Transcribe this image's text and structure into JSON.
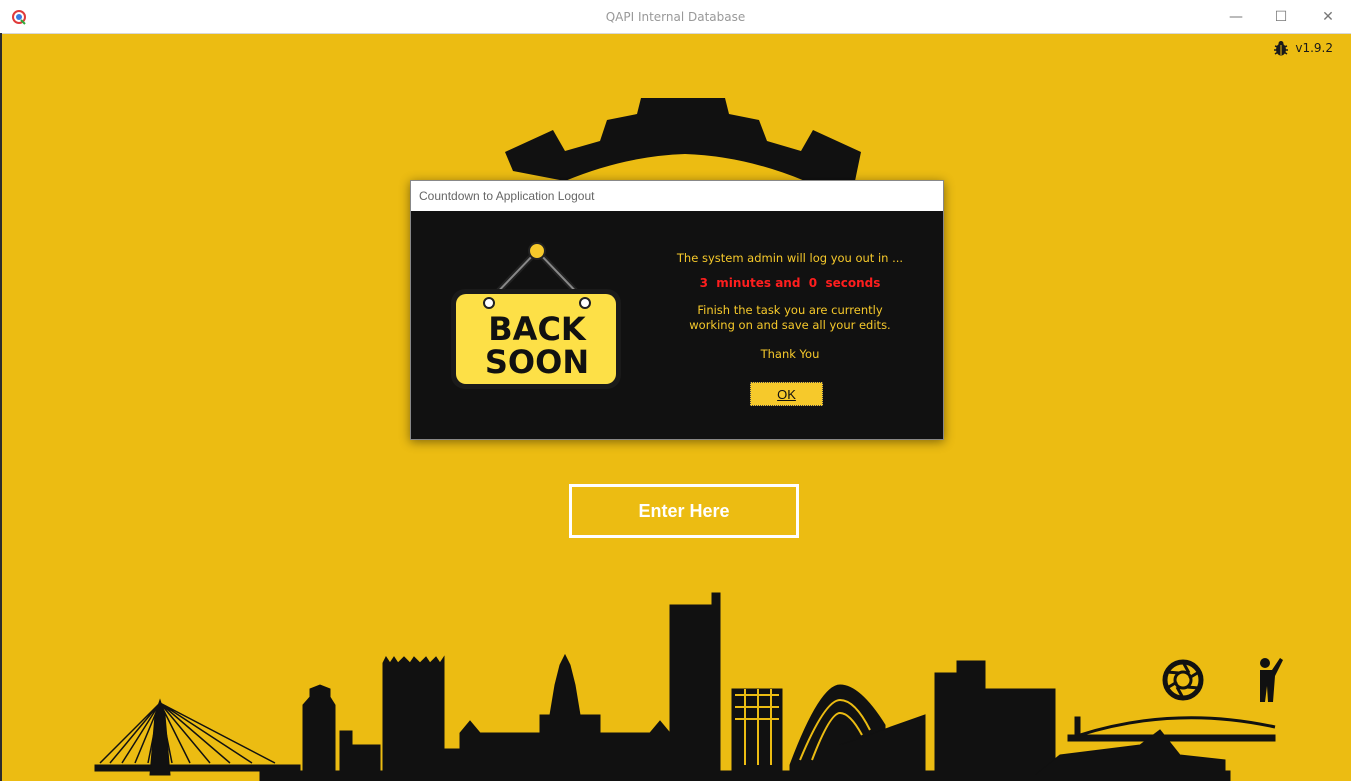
{
  "window": {
    "title": "QAPI Internal Database",
    "controls": {
      "minimize": "—",
      "maximize": "☐",
      "close": "✕"
    }
  },
  "header": {
    "version": "v1.9.2",
    "bug_icon": "bug-icon"
  },
  "main": {
    "enter_button": "Enter Here",
    "icons": [
      "gear-icon",
      "camera-aperture-icon",
      "waving-person-icon"
    ]
  },
  "dialog": {
    "title": "Countdown to Application Logout",
    "sign_line1": "BACK",
    "sign_line2": "SOON",
    "line1": "The system admin will log you out in ...",
    "countdown": "3  minutes and  0  seconds",
    "line3a": "Finish the task you are currently",
    "line3b": "working on and save all your edits.",
    "thanks": "Thank You",
    "ok_label": "OK"
  },
  "colors": {
    "background": "#ecbc12",
    "dialog_bg": "#111111",
    "accent_text": "#f6c92b",
    "countdown": "#ff1e1e"
  }
}
